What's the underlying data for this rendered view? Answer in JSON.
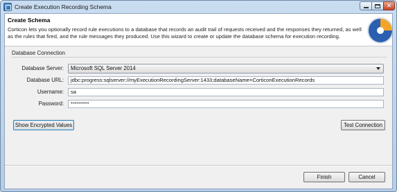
{
  "window": {
    "title": "Create Execution Recording Schema"
  },
  "header": {
    "title": "Create Schema",
    "description": "Corticon lets you optionally record rule executions to a database that records an audit trail of requests received and the responses they returned, as well as the rules that fired, and the rule messages they produced. Use this wizard to create or update the database schema for execution recording."
  },
  "connection": {
    "group_title": "Database Connection",
    "server_label": "Database Server:",
    "server_value": "Microsoft SQL Server 2014",
    "url_label": "Database URL:",
    "url_value": "jdbc:progress:sqlserver://myExecutionRecordingServer:1433;databaseName=CorticonExecutionRecords",
    "username_label": "Username:",
    "username_value": "sa",
    "password_label": "Password:",
    "password_value": "*********"
  },
  "actions": {
    "show_encrypted": "Show Encrypted Values",
    "test_connection": "Test Connection",
    "finish": "Finish",
    "cancel": "Cancel"
  },
  "icons": {
    "app": "app-icon",
    "wizard_graphic": "database-wizard-icon",
    "minimize": "minimize-icon",
    "maximize": "maximize-icon",
    "close": "close-icon",
    "dropdown": "chevron-down-icon"
  }
}
